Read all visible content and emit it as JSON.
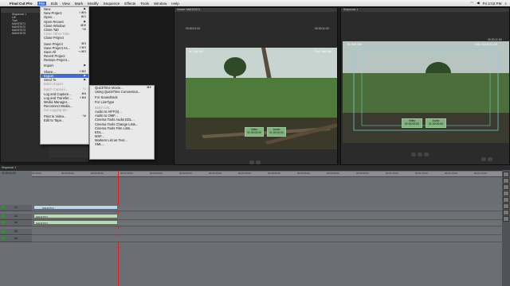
{
  "menubar": {
    "app_name": "Final Cut Pro",
    "items": [
      "File",
      "Edit",
      "View",
      "Mark",
      "Modify",
      "Sequence",
      "Effects",
      "Tools",
      "Window",
      "Help"
    ],
    "clock": "Fri 2:02 PM"
  },
  "file_menu": {
    "items": [
      {
        "label": "New",
        "shortcut": "▶",
        "enabled": true
      },
      {
        "label": "New Project",
        "shortcut": "⇧⌘N",
        "enabled": true
      },
      {
        "label": "Open...",
        "shortcut": "⌘O",
        "enabled": true
      },
      {
        "label": "Open Recent",
        "shortcut": "▶",
        "enabled": true
      },
      {
        "label": "Close Window",
        "shortcut": "⌘W",
        "enabled": true
      },
      {
        "label": "Close Tab",
        "shortcut": "^W",
        "enabled": true
      },
      {
        "label": "Close Other Tabs",
        "shortcut": "",
        "enabled": false
      },
      {
        "label": "Close Project",
        "shortcut": "",
        "enabled": true
      },
      {
        "label": "",
        "separator": true
      },
      {
        "label": "Save Project",
        "shortcut": "⌘S",
        "enabled": true
      },
      {
        "label": "Save Project As...",
        "shortcut": "⇧⌘S",
        "enabled": true
      },
      {
        "label": "Save All",
        "shortcut": "⌥⌘S",
        "enabled": true
      },
      {
        "label": "Revert Project",
        "shortcut": "",
        "enabled": true
      },
      {
        "label": "Restore Project...",
        "shortcut": "",
        "enabled": true
      },
      {
        "label": "",
        "separator": true
      },
      {
        "label": "Import",
        "shortcut": "▶",
        "enabled": true
      },
      {
        "label": "",
        "separator": true
      },
      {
        "label": "Share...",
        "shortcut": "⇧⌘E",
        "enabled": true
      },
      {
        "label": "Export",
        "shortcut": "▶",
        "enabled": true,
        "highlighted": true
      },
      {
        "label": "Send To",
        "shortcut": "▶",
        "enabled": true
      },
      {
        "label": "Batch Export",
        "shortcut": "",
        "enabled": false
      },
      {
        "label": "",
        "separator": true
      },
      {
        "label": "Batch Capture...",
        "shortcut": "^C",
        "enabled": false
      },
      {
        "label": "Log and Capture...",
        "shortcut": "⌘8",
        "enabled": true
      },
      {
        "label": "Log and Transfer...",
        "shortcut": "⇧⌘8",
        "enabled": true
      },
      {
        "label": "Media Manager...",
        "shortcut": "",
        "enabled": true
      },
      {
        "label": "Reconnect Media...",
        "shortcut": "",
        "enabled": true
      },
      {
        "label": "Set Logging Bin",
        "shortcut": "",
        "enabled": false
      },
      {
        "label": "",
        "separator": true
      },
      {
        "label": "Print to Video...",
        "shortcut": "^M",
        "enabled": true
      },
      {
        "label": "Edit to Tape...",
        "shortcut": "",
        "enabled": true
      }
    ]
  },
  "export_menu": {
    "items": [
      {
        "label": "QuickTime Movie...",
        "shortcut": "⌘E"
      },
      {
        "label": "Using QuickTime Conversion...",
        "shortcut": ""
      },
      {
        "label": "",
        "separator": true
      },
      {
        "label": "For Soundtrack",
        "shortcut": ""
      },
      {
        "label": "For LiveType",
        "shortcut": ""
      },
      {
        "label": "",
        "separator": true
      },
      {
        "label": "Batch List...",
        "shortcut": "",
        "disabled": true
      },
      {
        "label": "Audio to AIFF(s)...",
        "shortcut": ""
      },
      {
        "label": "Audio to OMF...",
        "shortcut": ""
      },
      {
        "label": "Cinema Tools Audio EDL...",
        "shortcut": ""
      },
      {
        "label": "Cinema Tools Change Lists...",
        "shortcut": ""
      },
      {
        "label": "Cinema Tools Film Lists...",
        "shortcut": ""
      },
      {
        "label": "EDL...",
        "shortcut": ""
      },
      {
        "label": "MXF...",
        "shortcut": ""
      },
      {
        "label": "Markers List as Text...",
        "shortcut": ""
      },
      {
        "label": "XML...",
        "shortcut": ""
      }
    ]
  },
  "browser": {
    "tab_label": "Sequence 1",
    "rows": [
      "Sequence 1",
      "Lift",
      "Trail",
      "MAH07671",
      "MAH07672",
      "MAH07673",
      "MAH07675"
    ]
  },
  "viewer": {
    "tab_label": "Viewer: MAH07671",
    "timecode_left": "00:00:01:04",
    "timecode_right": "00:00:11:03",
    "in_label": "In: Not Set",
    "out_label": "Out: Not Set",
    "video_label": "Video",
    "audio_label": "Audio",
    "video_tc": "01:00:00:00",
    "audio_tc": "01:00:00:00"
  },
  "canvas": {
    "tab_label": "Sequence 1",
    "timecode_right": "00:00:11:00",
    "in_label": "In: Not Set",
    "out_label": "Out: 00:00:11:00",
    "video_label": "Video",
    "audio_label": "Audio",
    "video_tc": "01:00:00:00",
    "audio_tc": "01:00:00:00"
  },
  "timeline": {
    "tab_label": "Sequence 1",
    "timecode": "01:00:11:00",
    "ruler_ticks": [
      "01:00:00",
      "00:00:05:00",
      "00:00:10:00",
      "00:00:15:00",
      "00:00:20:00",
      "00:00:25:00",
      "00:00:30:00",
      "00:00:35:00",
      "00:00:40:00",
      "00:00:45:00",
      "00:00:50:00",
      "00:00:55:00",
      "00:01:00:00",
      "00:01:05:00",
      "00:01:10:00",
      "00:01:15:00"
    ],
    "tracks": [
      {
        "id": "V1",
        "type": "video",
        "clip": "MAH07671"
      },
      {
        "id": "A1",
        "type": "audio",
        "clip": "MAH07671"
      },
      {
        "id": "A2",
        "type": "audio",
        "clip": "MAH07671"
      },
      {
        "id": "A3",
        "type": "audio",
        "clip": ""
      },
      {
        "id": "A4",
        "type": "audio",
        "clip": ""
      }
    ]
  },
  "colors": {
    "menu_highlight": "#3b6fd6",
    "video_clip": "#b9d7ef",
    "audio_clip": "#b8dcb5",
    "timeline_bg": "#6b6e73"
  }
}
